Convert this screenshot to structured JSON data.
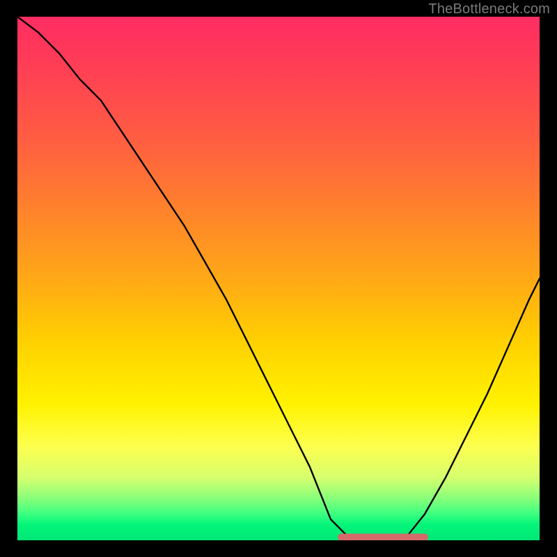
{
  "watermark": "TheBottleneck.com",
  "colors": {
    "line": "#000000",
    "accent": "#d46a6a",
    "border": "#000000"
  },
  "chart_data": {
    "type": "line",
    "title": "",
    "xlabel": "",
    "ylabel": "",
    "xlim": [
      0,
      100
    ],
    "ylim": [
      0,
      100
    ],
    "series": [
      {
        "name": "curve",
        "x": [
          0,
          4,
          8,
          12,
          16,
          20,
          24,
          28,
          32,
          36,
          40,
          44,
          48,
          52,
          56,
          58,
          60,
          63,
          66,
          70,
          74,
          78,
          82,
          86,
          90,
          94,
          98,
          100
        ],
        "y": [
          100,
          97,
          93,
          88,
          84,
          78,
          72,
          66,
          60,
          53,
          46,
          38,
          30,
          22,
          14,
          9,
          4,
          1,
          0,
          0,
          0,
          5,
          12,
          20,
          28,
          37,
          46,
          50
        ]
      }
    ],
    "accent_segment": {
      "comment": "flat horizontal pink segment at bottom of valley",
      "x_start": 62,
      "x_end": 78,
      "y": 0.6
    }
  }
}
